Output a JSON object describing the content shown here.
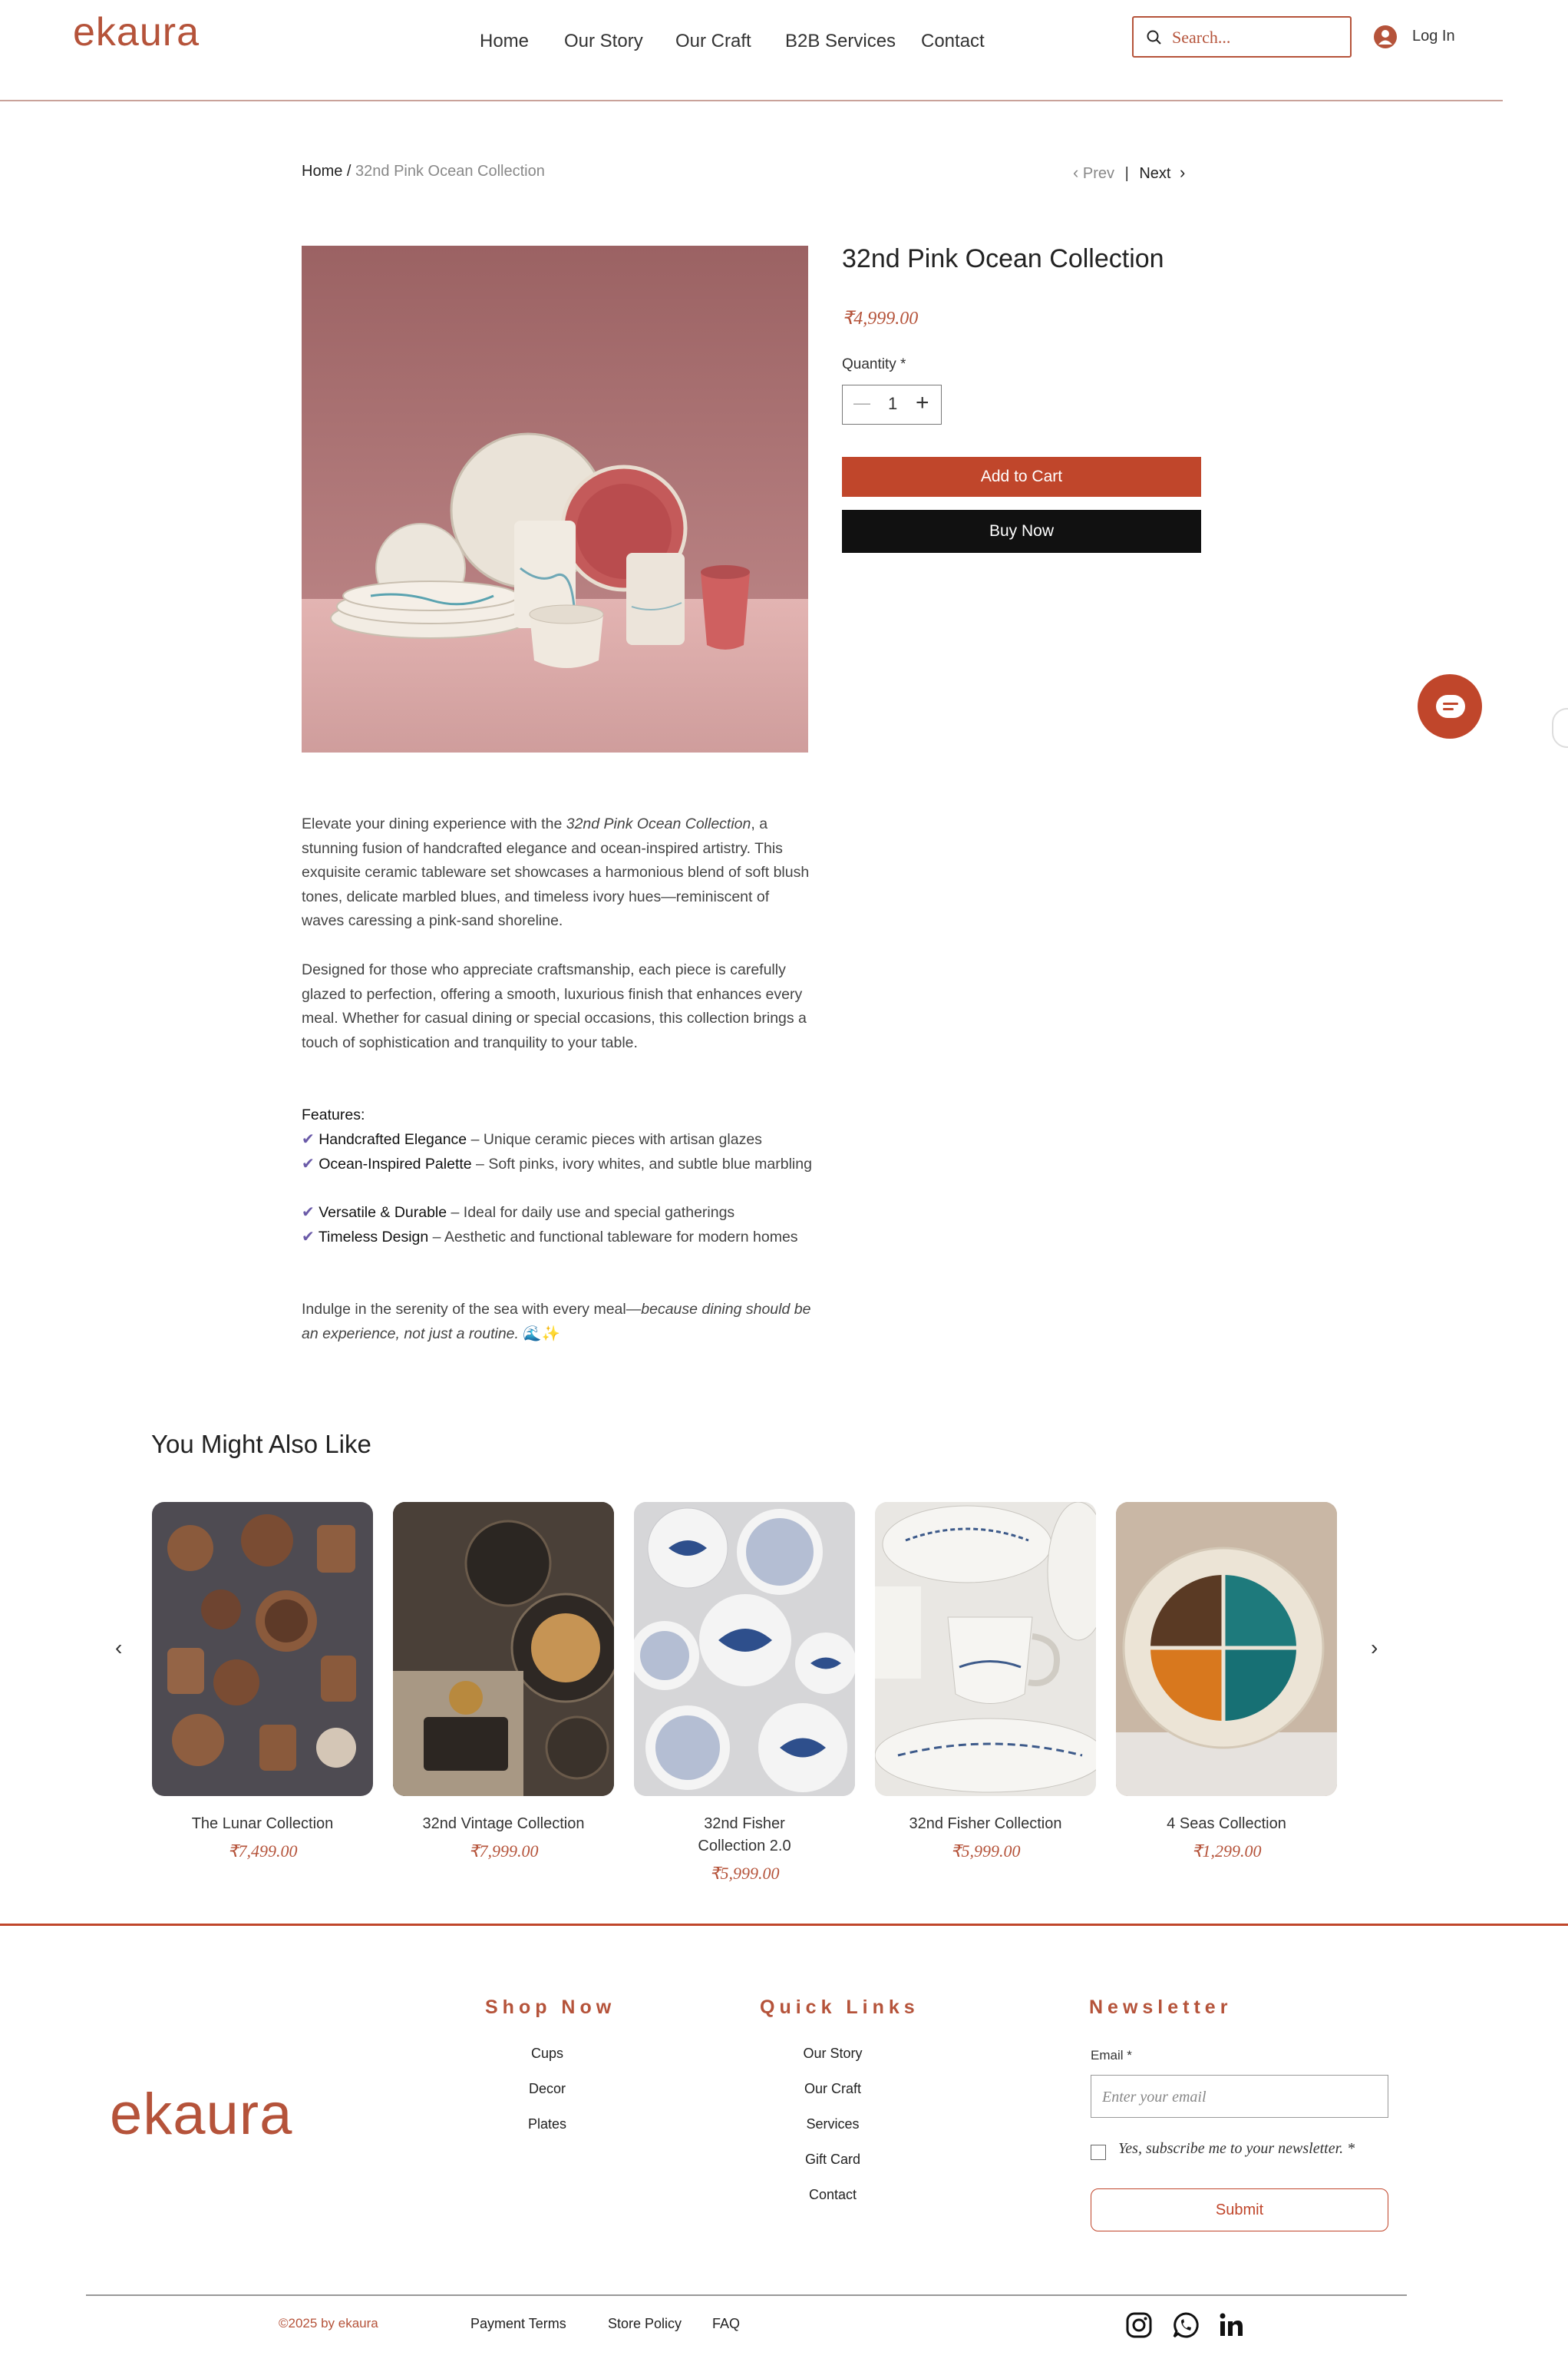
{
  "header": {
    "logo": "ekaura",
    "nav": [
      "Home",
      "Our Story",
      "Our Craft",
      "B2B Services",
      "Contact"
    ],
    "search_placeholder": "Search...",
    "login": "Log In"
  },
  "breadcrumb": {
    "home": "Home",
    "separator": "/",
    "current": "32nd Pink Ocean Collection",
    "prev": "Prev",
    "divider": "|",
    "next": "Next"
  },
  "product": {
    "title": "32nd Pink Ocean Collection",
    "price": "₹4,999.00",
    "quantity_label": "Quantity *",
    "quantity_value": "1",
    "add_to_cart": "Add to Cart",
    "buy_now": "Buy Now"
  },
  "description": {
    "p1_a": "Elevate your dining experience with the ",
    "p1_em": "32nd Pink Ocean Collection",
    "p1_b": ", a stunning fusion of handcrafted elegance and ocean-inspired artistry. This exquisite ceramic tableware set showcases a harmonious blend of soft blush tones, delicate marbled blues, and timeless ivory hues—reminiscent of waves caressing a pink-sand shoreline.",
    "p2": "Designed for those who appreciate craftsmanship, each piece is carefully glazed to perfection, offering a smooth, luxurious finish that enhances every meal. Whether for casual dining or special occasions, this collection brings a touch of sophistication and tranquility to your table.",
    "features_heading": "Features:",
    "features": [
      {
        "name": "Handcrafted Elegance",
        "text": " – Unique ceramic pieces with artisan glazes"
      },
      {
        "name": "Ocean-Inspired Palette",
        "text": " – Soft pinks, ivory whites, and subtle blue marbling"
      },
      {
        "name": "Versatile & Durable",
        "text": " – Ideal for daily use and special gatherings"
      },
      {
        "name": "Timeless Design",
        "text": " – Aesthetic and functional tableware for modern homes"
      }
    ],
    "p3_a": "Indulge in the serenity of the sea with every meal—",
    "p3_em": "because dining should be an experience, not just a routine.",
    "p3_emoji": " 🌊✨"
  },
  "related": {
    "heading": "You Might Also Like",
    "items": [
      {
        "name": "The Lunar Collection",
        "price": "₹7,499.00"
      },
      {
        "name": "32nd Vintage Collection",
        "price": "₹7,999.00"
      },
      {
        "name": "32nd Fisher Collection 2.0",
        "price": "₹5,999.00"
      },
      {
        "name": "32nd Fisher Collection",
        "price": "₹5,999.00"
      },
      {
        "name": "4 Seas Collection",
        "price": "₹1,299.00"
      }
    ]
  },
  "footer": {
    "logo": "ekaura",
    "shop_heading": "Shop Now",
    "shop_links": [
      "Cups",
      "Decor",
      "Plates"
    ],
    "quick_heading": "Quick Links",
    "quick_links": [
      "Our Story",
      "Our Craft",
      "Services",
      "Gift Card",
      "Contact"
    ],
    "newsletter_heading": "Newsletter",
    "email_label": "Email *",
    "email_placeholder": "Enter your email",
    "subscribe_label": "Yes, subscribe me to your newsletter. *",
    "submit": "Submit",
    "copyright": "©2025 by ekaura",
    "bottom_links": [
      "Payment Terms",
      "Store Policy",
      "FAQ"
    ]
  },
  "colors": {
    "brand": "#b5533a",
    "button": "#c0462b",
    "dark": "#111111",
    "check": "#6a5aa8"
  }
}
